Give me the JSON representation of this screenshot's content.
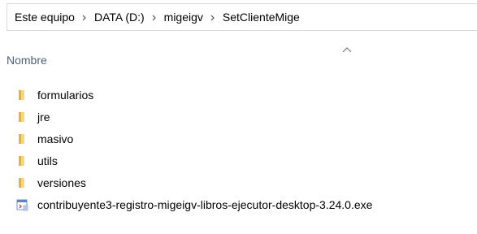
{
  "breadcrumb": {
    "items": [
      {
        "label": "Este equipo"
      },
      {
        "label": "DATA (D:)"
      },
      {
        "label": "migeigv"
      },
      {
        "label": "SetClienteMige"
      }
    ]
  },
  "columns": {
    "name_header": "Nombre",
    "sort_direction": "ascending"
  },
  "files": [
    {
      "name": "formularios",
      "icon": "folder-icon"
    },
    {
      "name": "jre",
      "icon": "folder-icon"
    },
    {
      "name": "masivo",
      "icon": "folder-icon"
    },
    {
      "name": "utils",
      "icon": "folder-icon"
    },
    {
      "name": "versiones",
      "icon": "folder-icon"
    },
    {
      "name": "contribuyente3-registro-migeigv-libros-ejecutor-desktop-3.24.0.exe",
      "icon": "exe-icon"
    }
  ],
  "colors": {
    "folder_yellow": "#f8d775",
    "folder_dark": "#e0b440",
    "header_text": "#4c607a"
  }
}
